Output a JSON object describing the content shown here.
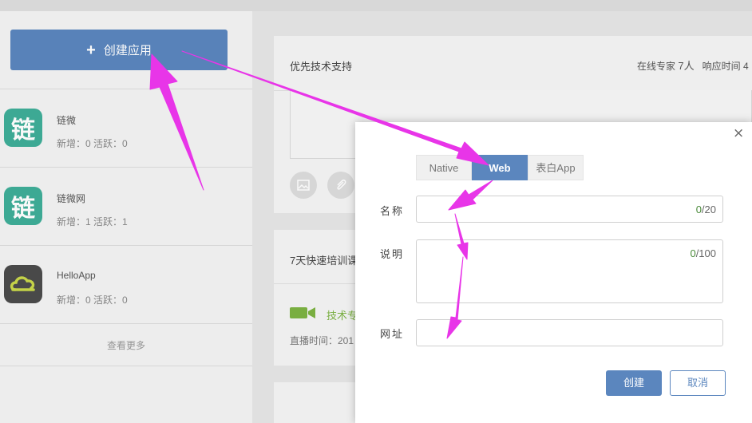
{
  "sidebar": {
    "create_label": "创建应用",
    "apps": [
      {
        "name": "链微",
        "icon_char": "链",
        "stats": "新增：0   活跃：0"
      },
      {
        "name": "链微网",
        "icon_char": "链",
        "stats": "新增：1   活跃：1"
      },
      {
        "name": "HelloApp",
        "icon_char": "",
        "stats": "新增：0   活跃：0"
      }
    ],
    "more_label": "查看更多"
  },
  "support_panel": {
    "title": "优先技术支持",
    "online_label": "在线专家",
    "online_count": "7人",
    "response_label": "响应时间 4"
  },
  "training_panel": {
    "title": "7天快速培训课",
    "topic": "技术专",
    "live_time": "直播时间：201"
  },
  "dialog": {
    "tabs": [
      "Native",
      "Web",
      "表白App"
    ],
    "active_tab": "Web",
    "name_label": "名称",
    "name_count_current": "0",
    "name_count_max": "/20",
    "desc_label": "说明",
    "desc_count_current": "0",
    "desc_count_max": "/100",
    "url_label": "网址",
    "create_label": "创建",
    "cancel_label": "取消",
    "close_glyph": "×"
  },
  "colors": {
    "primary": "#5b86be",
    "app_green": "#3fae98",
    "arrow_magenta": "#e835e8",
    "count_green": "#4a8a3a"
  }
}
